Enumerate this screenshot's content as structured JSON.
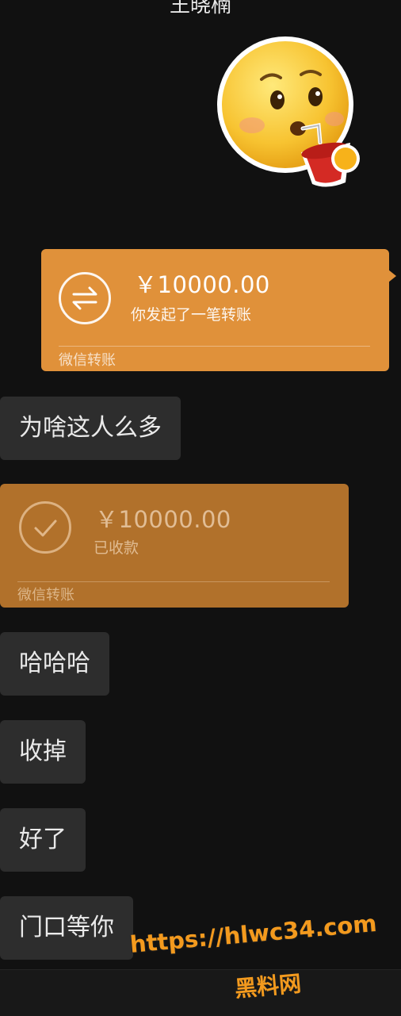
{
  "header": {
    "contact_name": "王晓楠"
  },
  "sticker": {
    "icon": "sipping-drink-emoji-icon"
  },
  "messages": [
    {
      "type": "transfer_sent",
      "amount": "￥10000.00",
      "status": "你发起了一笔转账",
      "footer": "微信转账",
      "icon": "transfer-arrows-icon"
    },
    {
      "type": "text",
      "text": "为啥这人么多"
    },
    {
      "type": "transfer_received",
      "amount": "￥10000.00",
      "status": "已收款",
      "footer": "微信转账",
      "icon": "checkmark-icon"
    },
    {
      "type": "text",
      "text": "哈哈哈"
    },
    {
      "type": "text",
      "text": "收掉"
    },
    {
      "type": "text",
      "text": "好了"
    },
    {
      "type": "text",
      "text": "门口等你"
    }
  ],
  "watermark": {
    "url": "https://hlwc34.com",
    "name": "黑料网"
  },
  "colors": {
    "background": "#111111",
    "transfer_sent": "#e0913a",
    "transfer_received": "#b1712b",
    "bubble": "#2d2d2d",
    "watermark": "#f39a1e"
  }
}
